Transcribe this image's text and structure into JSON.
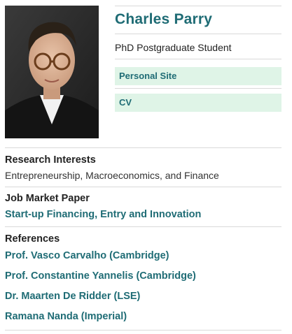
{
  "profile": {
    "name": "Charles Parry",
    "position": "PhD Postgraduate Student",
    "links": [
      {
        "label": "Personal Site"
      },
      {
        "label": "CV"
      }
    ]
  },
  "research": {
    "heading": "Research Interests",
    "text": "Entrepreneurship, Macroeconomics, and Finance"
  },
  "job_market": {
    "heading": "Job Market Paper",
    "paper": "Start-up Financing, Entry and Innovation"
  },
  "references": {
    "heading": "References",
    "items": [
      "Prof. Vasco Carvalho (Cambridge)",
      "Prof. Constantine Yannelis (Cambridge)",
      "Dr. Maarten De Ridder (LSE)",
      "Ramana Nanda (Imperial)"
    ]
  },
  "colors": {
    "accent": "#1f6c75",
    "link_box_bg": "#dff4e7"
  }
}
